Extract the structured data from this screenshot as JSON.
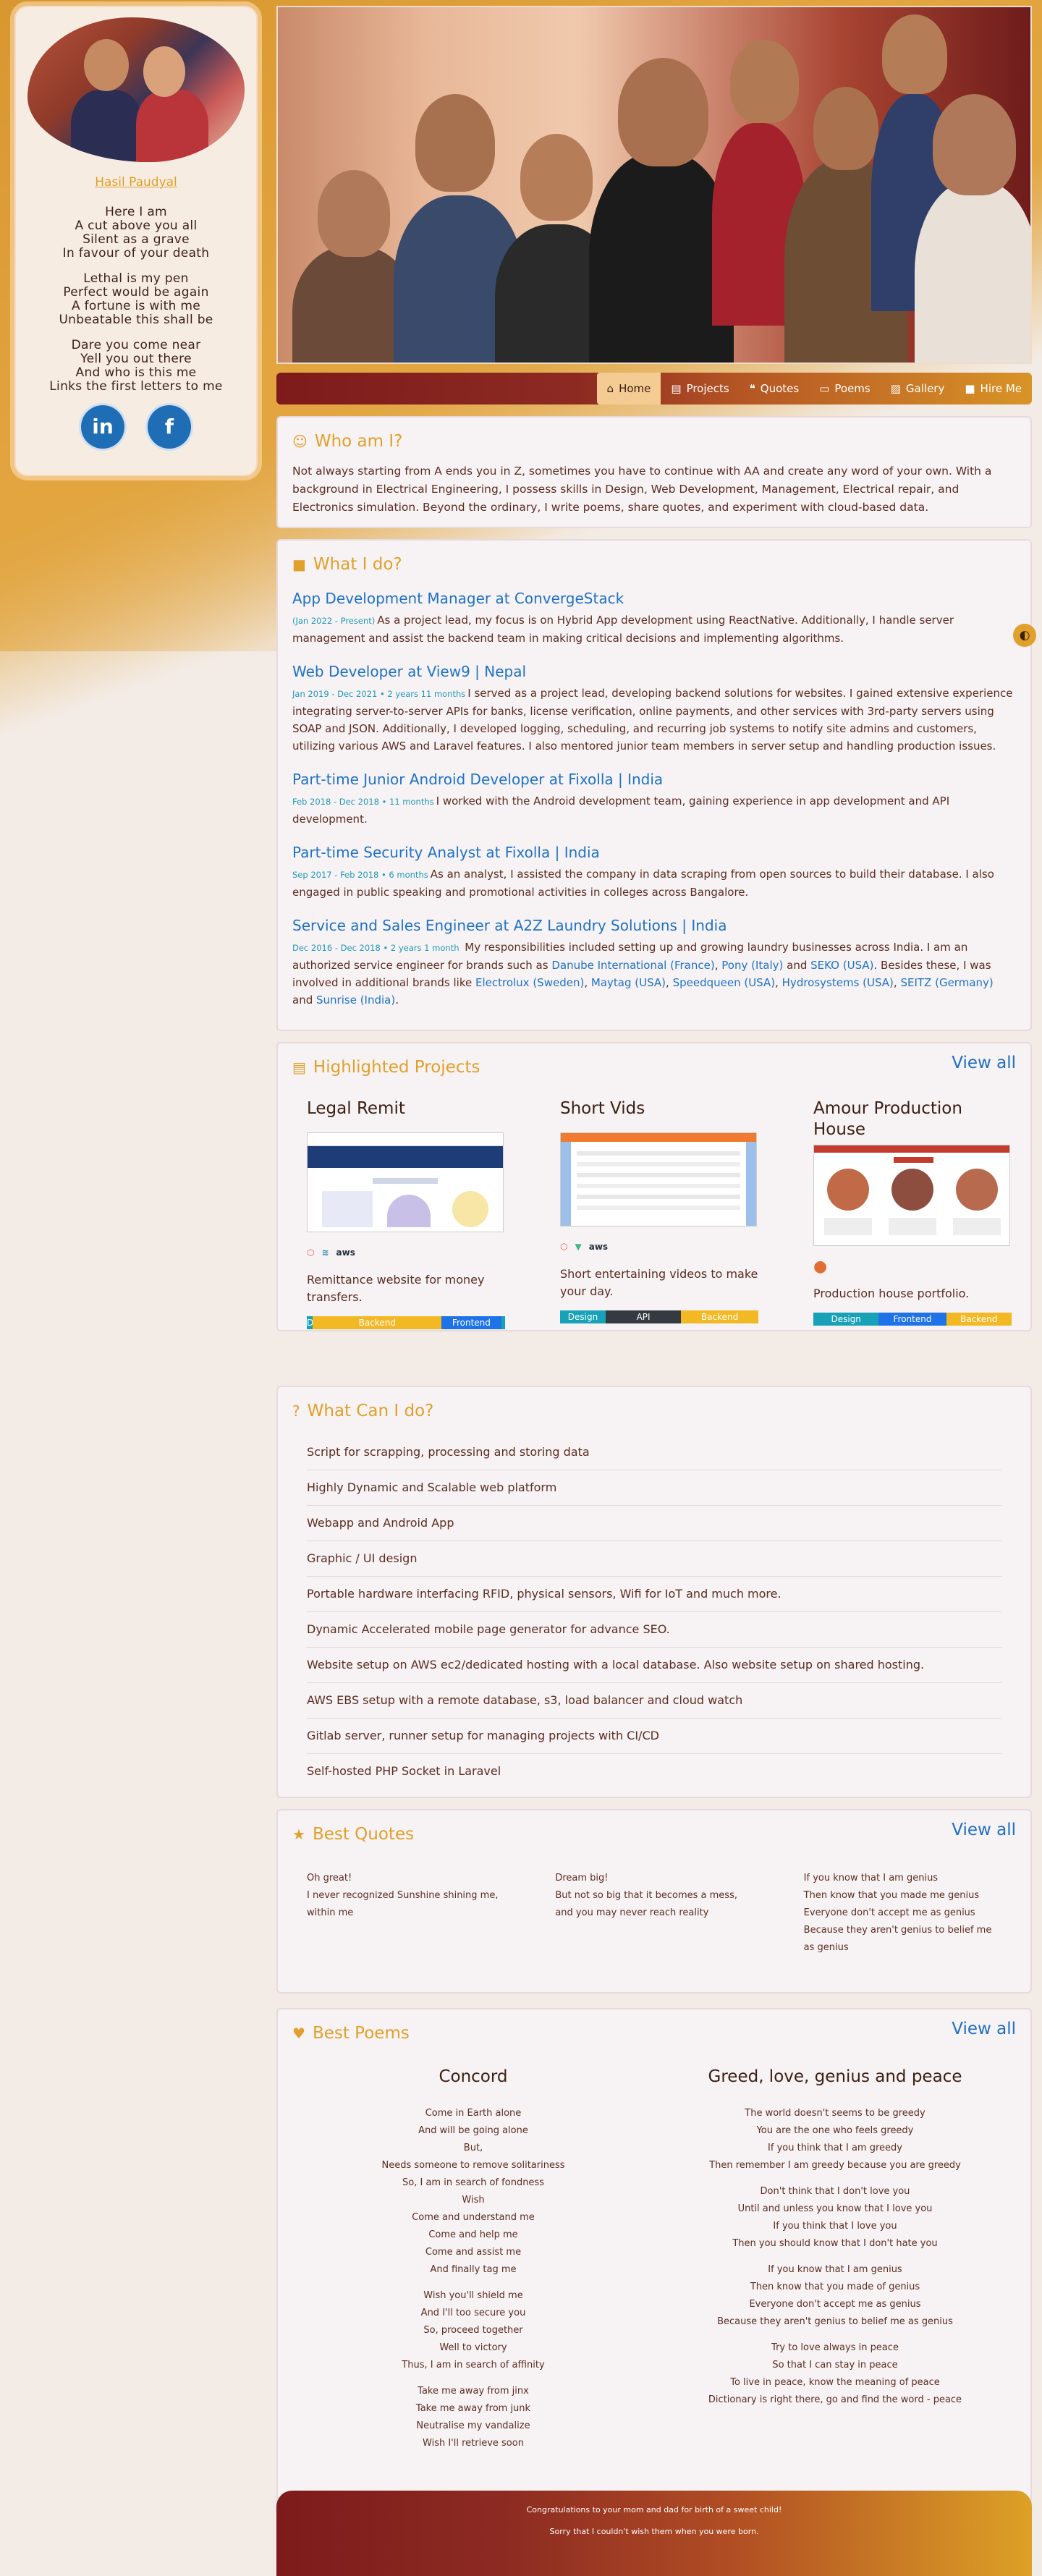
{
  "sidebar": {
    "name": "Hasil Paudyal",
    "poem": [
      [
        "Here I am",
        "A cut above you all",
        "Silent as a grave",
        "In favour of your death"
      ],
      [
        "Lethal is my pen",
        "Perfect would be again",
        "A fortune is with me",
        "Unbeatable this shall be"
      ],
      [
        "Dare you come near",
        "Yell you out there",
        "And who is this me",
        "Links the first letters to me"
      ]
    ],
    "socials": [
      {
        "icon": "linkedin-icon",
        "glyph": "in"
      },
      {
        "icon": "facebook-icon",
        "glyph": "f"
      }
    ]
  },
  "nav": {
    "items": [
      {
        "label": "Home",
        "icon": "home-icon",
        "glyph": "⌂"
      },
      {
        "label": "Projects",
        "icon": "projects-icon",
        "glyph": "▤"
      },
      {
        "label": "Quotes",
        "icon": "quotes-icon",
        "glyph": "❝"
      },
      {
        "label": "Poems",
        "icon": "poems-icon",
        "glyph": "▭"
      },
      {
        "label": "Gallery",
        "icon": "gallery-icon",
        "glyph": "▨"
      },
      {
        "label": "Hire Me",
        "icon": "briefcase-icon",
        "glyph": "■"
      }
    ]
  },
  "about": {
    "title": "Who am I?",
    "icon": "smile-icon",
    "text": "Not always starting from A ends you in Z, sometimes you have to continue with AA and create any word of your own. With a background in Electrical Engineering, I possess skills in Design, Web Development, Management, Electrical repair, and Electronics simulation. Beyond the ordinary, I write poems, share quotes, and experiment with cloud-based data."
  },
  "experience": {
    "title": "What I do?",
    "icon": "briefcase-icon",
    "jobs": [
      {
        "title": "App Development Manager at ConvergeStack",
        "date": "(Jan 2022 - Present)",
        "text": "As a project lead, my focus is on Hybrid App development using ReactNative. Additionally, I handle server management and assist the backend team in making critical decisions and implementing algorithms."
      },
      {
        "title": "Web Developer at View9 | Nepal",
        "date": "Jan 2019 - Dec 2021 • 2 years 11 months",
        "text": "I served as a project lead, developing backend solutions for websites. I gained extensive experience integrating server-to-server APIs for banks, license verification, online payments, and other services with 3rd-party servers using SOAP and JSON. Additionally, I developed logging, scheduling, and recurring job systems to notify site admins and customers, utilizing various AWS and Laravel features. I also mentored junior team members in server setup and handling production issues."
      },
      {
        "title": "Part-time Junior Android Developer at Fixolla | India",
        "date": "Feb 2018 - Dec 2018 • 11 months",
        "text": "I worked with the Android development team, gaining experience in app development and API development."
      },
      {
        "title": "Part-time Security Analyst at Fixolla | India",
        "date": "Sep 2017 - Feb 2018 • 6 months",
        "text": "As an analyst, I assisted the company in data scraping from open sources to build their database. I also engaged in public speaking and promotional activities in colleges across Bangalore."
      },
      {
        "title": "Service and Sales Engineer at A2Z Laundry Solutions | India",
        "date": "Dec 2016 - Dec 2018 • 2 years 1 month",
        "text_a": "My responsibilities included setting up and growing laundry businesses across India. I am an authorized service engineer for brands such as",
        "link_danube": "Danube International (France)",
        "sep_1": ",",
        "link_pony": "Pony (Italy)",
        "and_1": "and",
        "link_seko": "SEKO (USA)",
        "text_b": ". Besides these, I was involved in additional brands like",
        "link_electrolux": "Electrolux (Sweden)",
        "sep_2": ",",
        "link_maytag": "Maytag (USA)",
        "sep_3": ",",
        "link_speedqueen": "Speedqueen (USA)",
        "sep_4": ",",
        "link_hydrosystems": "Hydrosystems (USA)",
        "sep_5": ",",
        "link_seitz": "SEITZ (Germany)",
        "and_2": "and",
        "link_sunrise": "Sunrise (India)",
        "end": "."
      }
    ]
  },
  "projects": {
    "title": "Highlighted Projects",
    "icon": "projects-icon",
    "view_all": "View all",
    "items": [
      {
        "name": "Legal Remit",
        "desc": "Remittance website for money transfers.",
        "tech": [
          "laravel",
          "wave",
          "aws"
        ],
        "bar": [
          {
            "label": "De",
            "color": "#17a2b8",
            "pct": 3
          },
          {
            "label": "Backend",
            "color": "#f2b925",
            "pct": 65
          },
          {
            "label": "Frontend",
            "color": "#1e73e8",
            "pct": 30
          },
          {
            "label": "",
            "color": "#17a2b8",
            "pct": 2
          }
        ]
      },
      {
        "name": "Short Vids",
        "desc": "Short entertaining videos to make your day.",
        "tech": [
          "laravel",
          "vue",
          "aws"
        ],
        "bar": [
          {
            "label": "Design",
            "color": "#17a2b8",
            "pct": 23
          },
          {
            "label": "API",
            "color": "#343a40",
            "pct": 38
          },
          {
            "label": "Backend",
            "color": "#f2b925",
            "pct": 39
          }
        ]
      },
      {
        "name": "Amour Production House",
        "desc": "Production house portfolio.",
        "tech": [
          "drop"
        ],
        "bar": [
          {
            "label": "Design",
            "color": "#17a2b8",
            "pct": 33
          },
          {
            "label": "Frontend",
            "color": "#1e73e8",
            "pct": 34
          },
          {
            "label": "Backend",
            "color": "#f2b925",
            "pct": 33
          }
        ]
      }
    ]
  },
  "services": {
    "title": "What Can I do?",
    "icon": "question-icon",
    "items": [
      "Script for scrapping, processing and storing data",
      "Highly Dynamic and Scalable web platform",
      "Webapp and Android App",
      "Graphic / UI design",
      "Portable hardware interfacing RFID, physical sensors, Wifi for IoT and much more.",
      "Dynamic Accelerated mobile page generator for advance SEO.",
      "Website setup on AWS ec2/dedicated hosting with a local database. Also website setup on shared hosting.",
      "AWS EBS setup with a remote database, s3, load balancer and cloud watch",
      "Gitlab server, runner setup for managing projects with CI/CD",
      "Self-hosted PHP Socket in Laravel"
    ]
  },
  "quotes": {
    "title": "Best Quotes",
    "icon": "star-icon",
    "view_all": "View all",
    "items": [
      [
        "Oh great!",
        "I never recognized Sunshine shining me, within me"
      ],
      [
        "Dream big!",
        "But not so big that it becomes a mess, and you may never reach reality"
      ],
      [
        "If you know that I am genius",
        "Then know that you made me genius",
        "Everyone don't accept me as genius",
        "Because they aren't genius to belief me as genius"
      ]
    ]
  },
  "poems": {
    "title": "Best Poems",
    "icon": "heart-icon",
    "view_all": "View all",
    "items": [
      {
        "name": "Concord",
        "stanzas": [
          [
            "Come in Earth alone",
            "And will be going alone",
            "But,",
            "Needs someone to remove solitariness",
            "So, I am in search of fondness",
            "Wish",
            "Come and understand me",
            "Come and help me",
            "Come and assist me",
            "And finally tag me"
          ],
          [
            "Wish you'll shield me",
            "And I'll too secure you",
            "So, proceed together",
            "Well to victory",
            "Thus, I am in search of affinity"
          ],
          [
            "Take me away from jinx",
            "Take me away from junk",
            "Neutralise my vandalize",
            "Wish I'll retrieve soon"
          ]
        ]
      },
      {
        "name": "Greed, love, genius and peace",
        "stanzas": [
          [
            "The world doesn't seems to be greedy",
            "You are the one who feels greedy",
            "If you think that I am greedy",
            "Then remember I am greedy because you are greedy"
          ],
          [
            "Don't think that I don't love you",
            "Until and unless you know that I love you",
            "If you think that I love you",
            "Then you should know that I don't hate you"
          ],
          [
            "If you know that I am genius",
            "Then know that you made of genius",
            "Everyone don't accept me as genius",
            "Because they aren't genius to belief me as genius"
          ],
          [
            "Try to love always in peace",
            "So that I can stay in peace",
            "To live in peace, know the meaning of peace",
            "Dictionary is right there, go and find the word - peace"
          ]
        ]
      }
    ]
  },
  "footer": {
    "line1": "Congratulations to your mom and dad for birth of a sweet child!",
    "line2": "Sorry that I couldn't wish them when you were born."
  },
  "colors": {
    "accent": "#e1a02b",
    "link": "#1e72c8",
    "nav_dark": "#7d1b1c"
  }
}
